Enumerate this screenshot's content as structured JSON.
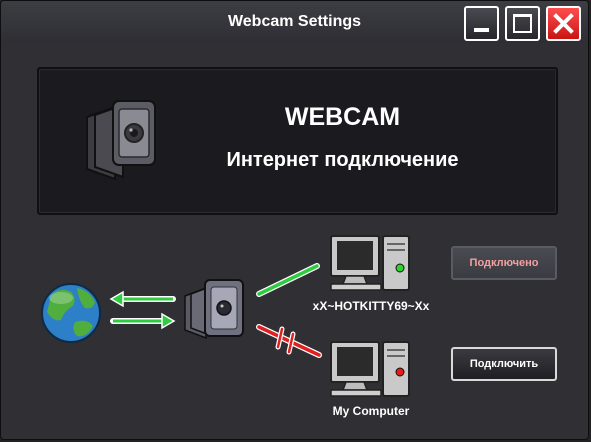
{
  "window": {
    "title": "Webcam Settings"
  },
  "banner": {
    "title": "WEBCAM",
    "subtitle": "Интернет подключение"
  },
  "network": {
    "remote_computer_label": "xX~HOTKITTY69~Xx",
    "local_computer_label": "My Computer"
  },
  "buttons": {
    "connected_label": "Подключено",
    "connect_label": "Подключить"
  },
  "colors": {
    "link_ok": "#2ecc40",
    "link_broken": "#e02020",
    "status_ok": "#2bd62b",
    "status_bad": "#e81b1b"
  },
  "icons": [
    "minimize-icon",
    "maximize-icon",
    "close-icon",
    "webcam-icon",
    "globe-icon",
    "computer-icon"
  ]
}
